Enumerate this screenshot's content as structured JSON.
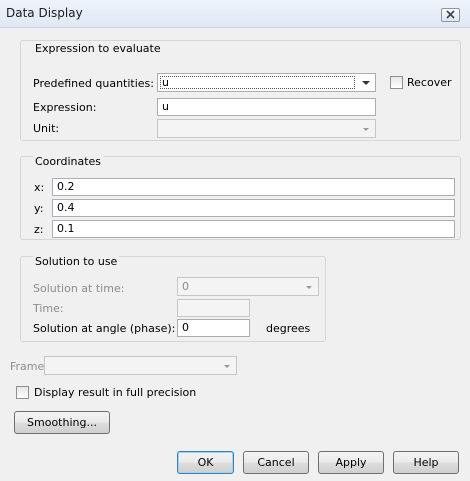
{
  "window": {
    "title": "Data Display"
  },
  "expression_group": {
    "title": "Expression to evaluate",
    "predefined_label": "Predefined quantities:",
    "predefined_value": "u",
    "recover_label": "Recover",
    "expression_label": "Expression:",
    "expression_value": "u",
    "unit_label": "Unit:",
    "unit_value": ""
  },
  "coordinates_group": {
    "title": "Coordinates",
    "x_label": "x:",
    "x_value": "0.2",
    "y_label": "y:",
    "y_value": "0.4",
    "z_label": "z:",
    "z_value": "0.1"
  },
  "solution_group": {
    "title": "Solution to use",
    "time_select_label": "Solution at time:",
    "time_select_value": "0",
    "time_label": "Time:",
    "time_value": "",
    "angle_label": "Solution at angle (phase):",
    "angle_value": "0",
    "angle_unit": "degrees"
  },
  "frame": {
    "label": "Frame:",
    "value": ""
  },
  "full_precision": {
    "label": "Display result in full precision",
    "checked": false
  },
  "buttons": {
    "smoothing": "Smoothing...",
    "ok": "OK",
    "cancel": "Cancel",
    "apply": "Apply",
    "help": "Help"
  },
  "icons": {
    "close": "close-icon",
    "dropdown": "chevron-down-icon"
  }
}
